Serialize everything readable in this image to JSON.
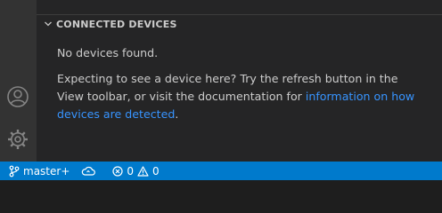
{
  "section": {
    "title": "CONNECTED DEVICES",
    "message": "No devices found.",
    "explanation_prefix": "Expecting to see a device here? Try the refresh button in the View toolbar, or visit the documentation for ",
    "link_text": "information on how devices are detected",
    "explanation_suffix": "."
  },
  "status_bar": {
    "branch": "master+",
    "errors": "0",
    "warnings": "0"
  },
  "icons": {
    "activity": [
      "account-icon",
      "settings-gear-icon"
    ],
    "section_toggle": "chevron-down-icon",
    "status": [
      "git-branch-icon",
      "cloud-sync-icon",
      "error-icon",
      "warning-icon"
    ]
  },
  "colors": {
    "status_bar": "#007acc",
    "link": "#3794ff",
    "sidebar": "#252526",
    "activity_bar": "#333333"
  }
}
